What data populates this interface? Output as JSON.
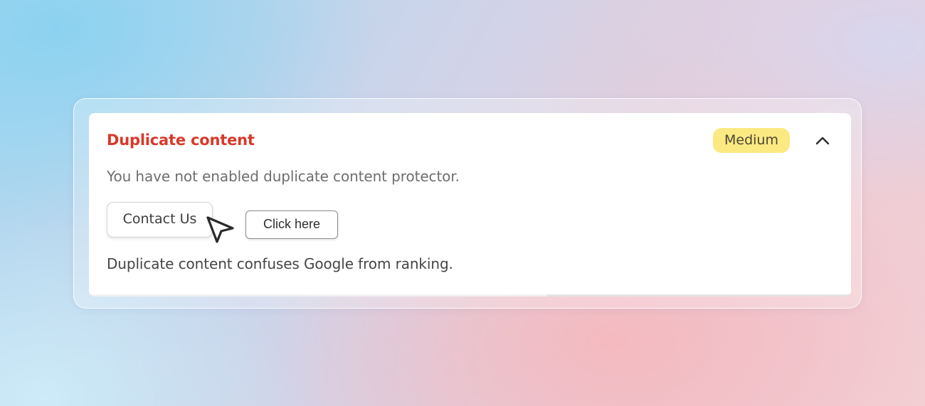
{
  "issue": {
    "title": "Duplicate content",
    "severity": "Medium",
    "description": "You have not enabled duplicate content protector.",
    "action_label": "Contact Us",
    "tooltip": "Click here",
    "note": "Duplicate content confuses Google from ranking.",
    "expanded": true,
    "progress_fraction": 0.6
  },
  "colors": {
    "title": "#d8392a",
    "badge_background": "#fbe982",
    "badge_text": "#4c4636"
  },
  "icons": {
    "toggle": "chevron-up-icon",
    "cursor": "pointer-arrow-icon"
  }
}
